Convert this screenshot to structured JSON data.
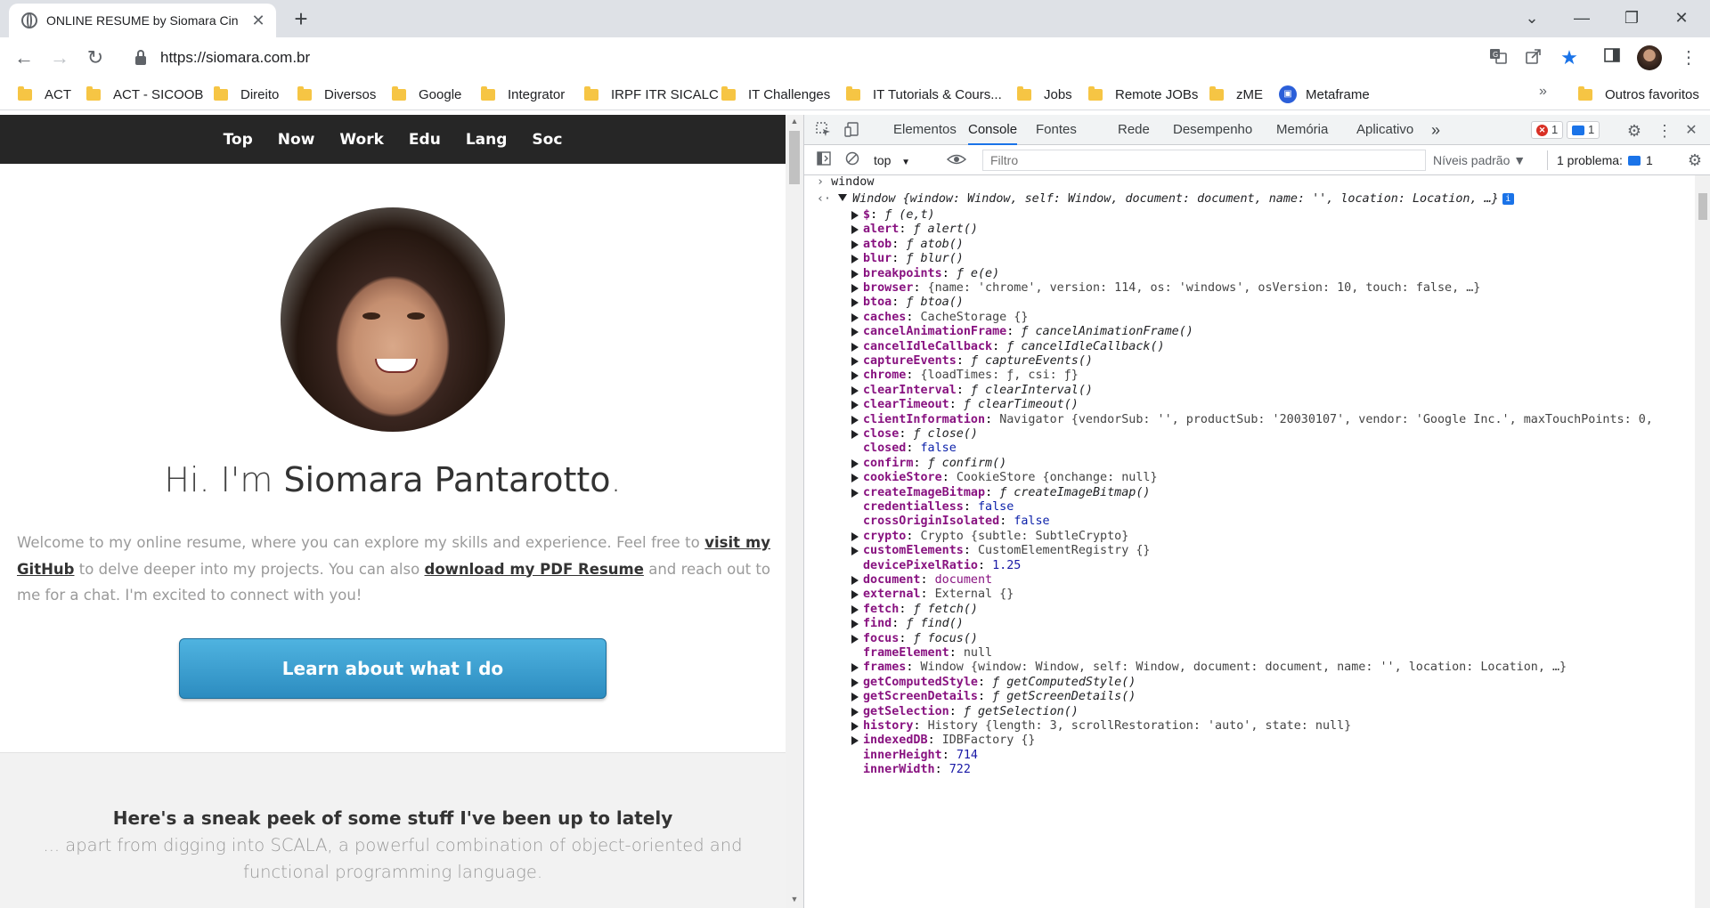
{
  "browser": {
    "tab_title": "ONLINE RESUME by Siomara Cin",
    "tab_close": "✕",
    "new_tab": "+",
    "url": "https://siomara.com.br",
    "window_controls": [
      "⌄",
      "—",
      "❐",
      "✕"
    ],
    "nav": {
      "back": "←",
      "forward": "→",
      "reload": "↻"
    },
    "toolbar_icons": [
      "translate-icon",
      "share-icon",
      "star-icon",
      "sidepanel-icon",
      "profile-avatar",
      "menu-icon"
    ],
    "bookmarks": [
      {
        "label": "ACT",
        "type": "folder"
      },
      {
        "label": "ACT - SICOOB",
        "type": "folder"
      },
      {
        "label": "Direito",
        "type": "folder"
      },
      {
        "label": "Diversos",
        "type": "folder"
      },
      {
        "label": "Google",
        "type": "folder"
      },
      {
        "label": "Integrator",
        "type": "folder"
      },
      {
        "label": "IRPF ITR SICALC",
        "type": "folder"
      },
      {
        "label": "IT Challenges",
        "type": "folder"
      },
      {
        "label": "IT Tutorials & Cours...",
        "type": "folder"
      },
      {
        "label": "Jobs",
        "type": "folder"
      },
      {
        "label": "Remote JOBs",
        "type": "folder"
      },
      {
        "label": "zME",
        "type": "folder"
      },
      {
        "label": "Metaframe",
        "type": "site"
      }
    ],
    "bookmarks_more": "»",
    "other_bookmarks": "Outros favoritos"
  },
  "page": {
    "nav_items": [
      "Top",
      "Now",
      "Work",
      "Edu",
      "Lang",
      "Soc"
    ],
    "headline_prefix": "Hi. I'm ",
    "headline_name": "Siomara Pantarotto",
    "headline_suffix": ".",
    "intro_1": "Welcome to my online resume, where you can explore my skills and experience. Feel free to ",
    "intro_link_1": "visit my GitHub",
    "intro_2": " to delve deeper into my projects. You can also ",
    "intro_link_2": "download my PDF Resume",
    "intro_3": " and reach out to me for a chat. I'm excited to connect with you!",
    "cta_label": "Learn about what I do",
    "section2_title": "Here's a sneak peek of some stuff I've been up to lately",
    "section2_text": "... apart from digging into SCALA, a powerful combination of object-oriented and functional programming language."
  },
  "devtools": {
    "tabs": [
      "Elementos",
      "Console",
      "Fontes",
      "Rede",
      "Desempenho",
      "Memória",
      "Aplicativo"
    ],
    "active_tab": "Console",
    "more_tabs": "»",
    "error_count": "1",
    "message_count": "1",
    "context": "top",
    "context_arrow": "▼",
    "filter_placeholder": "Filtro",
    "levels": "Níveis padrão ▼",
    "problems_label": "1 problema:",
    "problems_count": "1",
    "input_command": "window",
    "result_summary_head": "Window ",
    "result_summary": "{window: Window, self: Window, document: document, name: '', location: Location, …}",
    "properties": [
      {
        "key": "$",
        "value": "ƒ (e,t)",
        "kind": "fn",
        "expandable": true
      },
      {
        "key": "alert",
        "value": "ƒ alert()",
        "kind": "fn",
        "expandable": true
      },
      {
        "key": "atob",
        "value": "ƒ atob()",
        "kind": "fn",
        "expandable": true
      },
      {
        "key": "blur",
        "value": "ƒ blur()",
        "kind": "fn",
        "expandable": true
      },
      {
        "key": "breakpoints",
        "value": "ƒ e(e)",
        "kind": "fn",
        "expandable": true
      },
      {
        "key": "browser",
        "value": "{name: 'chrome', version: 114, os: 'windows', osVersion: 10, touch: false, …}",
        "kind": "obj",
        "expandable": true
      },
      {
        "key": "btoa",
        "value": "ƒ btoa()",
        "kind": "fn",
        "expandable": true
      },
      {
        "key": "caches",
        "value": "CacheStorage {}",
        "kind": "obj",
        "expandable": true
      },
      {
        "key": "cancelAnimationFrame",
        "value": "ƒ cancelAnimationFrame()",
        "kind": "fn",
        "expandable": true
      },
      {
        "key": "cancelIdleCallback",
        "value": "ƒ cancelIdleCallback()",
        "kind": "fn",
        "expandable": true
      },
      {
        "key": "captureEvents",
        "value": "ƒ captureEvents()",
        "kind": "fn",
        "expandable": true
      },
      {
        "key": "chrome",
        "value": "{loadTimes: ƒ, csi: ƒ}",
        "kind": "obj",
        "expandable": true
      },
      {
        "key": "clearInterval",
        "value": "ƒ clearInterval()",
        "kind": "fn",
        "expandable": true
      },
      {
        "key": "clearTimeout",
        "value": "ƒ clearTimeout()",
        "kind": "fn",
        "expandable": true
      },
      {
        "key": "clientInformation",
        "value": "Navigator {vendorSub: '', productSub: '20030107', vendor: 'Google Inc.', maxTouchPoints: 0,",
        "kind": "obj",
        "expandable": true
      },
      {
        "key": "close",
        "value": "ƒ close()",
        "kind": "fn",
        "expandable": true
      },
      {
        "key": "closed",
        "value": "false",
        "kind": "kw",
        "expandable": false
      },
      {
        "key": "confirm",
        "value": "ƒ confirm()",
        "kind": "fn",
        "expandable": true
      },
      {
        "key": "cookieStore",
        "value": "CookieStore {onchange: null}",
        "kind": "obj",
        "expandable": true
      },
      {
        "key": "createImageBitmap",
        "value": "ƒ createImageBitmap()",
        "kind": "fn",
        "expandable": true
      },
      {
        "key": "credentialless",
        "value": "false",
        "kind": "kw",
        "expandable": false
      },
      {
        "key": "crossOriginIsolated",
        "value": "false",
        "kind": "kw",
        "expandable": false
      },
      {
        "key": "crypto",
        "value": "Crypto {subtle: SubtleCrypto}",
        "kind": "obj",
        "expandable": true
      },
      {
        "key": "customElements",
        "value": "CustomElementRegistry {}",
        "kind": "obj",
        "expandable": true
      },
      {
        "key": "devicePixelRatio",
        "value": "1.25",
        "kind": "num",
        "expandable": false
      },
      {
        "key": "document",
        "value": "document",
        "kind": "str-obj",
        "expandable": true
      },
      {
        "key": "external",
        "value": "External {}",
        "kind": "obj",
        "expandable": true
      },
      {
        "key": "fetch",
        "value": "ƒ fetch()",
        "kind": "fn",
        "expandable": true
      },
      {
        "key": "find",
        "value": "ƒ find()",
        "kind": "fn",
        "expandable": true
      },
      {
        "key": "focus",
        "value": "ƒ focus()",
        "kind": "fn",
        "expandable": true
      },
      {
        "key": "frameElement",
        "value": "null",
        "kind": "null",
        "expandable": false
      },
      {
        "key": "frames",
        "value": "Window {window: Window, self: Window, document: document, name: '', location: Location, …}",
        "kind": "obj",
        "expandable": true
      },
      {
        "key": "getComputedStyle",
        "value": "ƒ getComputedStyle()",
        "kind": "fn",
        "expandable": true
      },
      {
        "key": "getScreenDetails",
        "value": "ƒ getScreenDetails()",
        "kind": "fn",
        "expandable": true
      },
      {
        "key": "getSelection",
        "value": "ƒ getSelection()",
        "kind": "fn",
        "expandable": true
      },
      {
        "key": "history",
        "value": "History {length: 3, scrollRestoration: 'auto', state: null}",
        "kind": "obj",
        "expandable": true
      },
      {
        "key": "indexedDB",
        "value": "IDBFactory {}",
        "kind": "obj",
        "expandable": true
      },
      {
        "key": "innerHeight",
        "value": "714",
        "kind": "num",
        "expandable": false
      },
      {
        "key": "innerWidth",
        "value": "722",
        "kind": "num",
        "expandable": false
      }
    ]
  }
}
